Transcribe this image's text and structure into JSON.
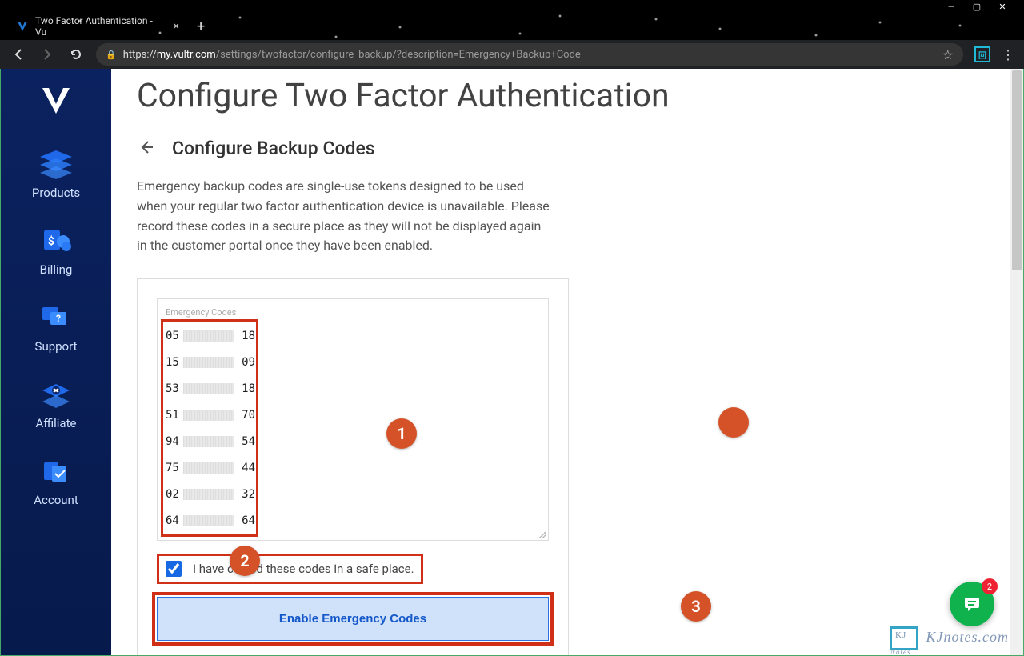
{
  "window": {
    "tab_title": "Two Factor Authentication - Vu",
    "url_scheme": "https://",
    "url_host": "my.vultr.com",
    "url_path": "/settings/twofactor/configure_backup/?description=Emergency+Backup+Code"
  },
  "sidebar": {
    "items": [
      {
        "label": "Products"
      },
      {
        "label": "Billing"
      },
      {
        "label": "Support"
      },
      {
        "label": "Affiliate"
      },
      {
        "label": "Account"
      }
    ]
  },
  "page": {
    "title": "Configure Two Factor Authentication",
    "subtitle": "Configure Backup Codes",
    "description": "Emergency backup codes are single-use tokens designed to be used when your regular two factor authentication device is unavailable. Please record these codes in a secure place as they will not be displayed again in the customer portal once they have been enabled.",
    "codes_label": "Emergency Codes",
    "codes": [
      {
        "start": "05",
        "end": "18"
      },
      {
        "start": "15",
        "end": "09"
      },
      {
        "start": "53",
        "end": "18"
      },
      {
        "start": "51",
        "end": "70"
      },
      {
        "start": "94",
        "end": "54"
      },
      {
        "start": "75",
        "end": "44"
      },
      {
        "start": "02",
        "end": "32"
      },
      {
        "start": "64",
        "end": "64"
      }
    ],
    "checkbox_label": "I have copied these codes in a safe place.",
    "enable_button": "Enable Emergency Codes"
  },
  "badges": {
    "b1": "1",
    "b2": "2",
    "b3": "3"
  },
  "chat": {
    "count": "2"
  },
  "watermark": "KJnotes.com"
}
